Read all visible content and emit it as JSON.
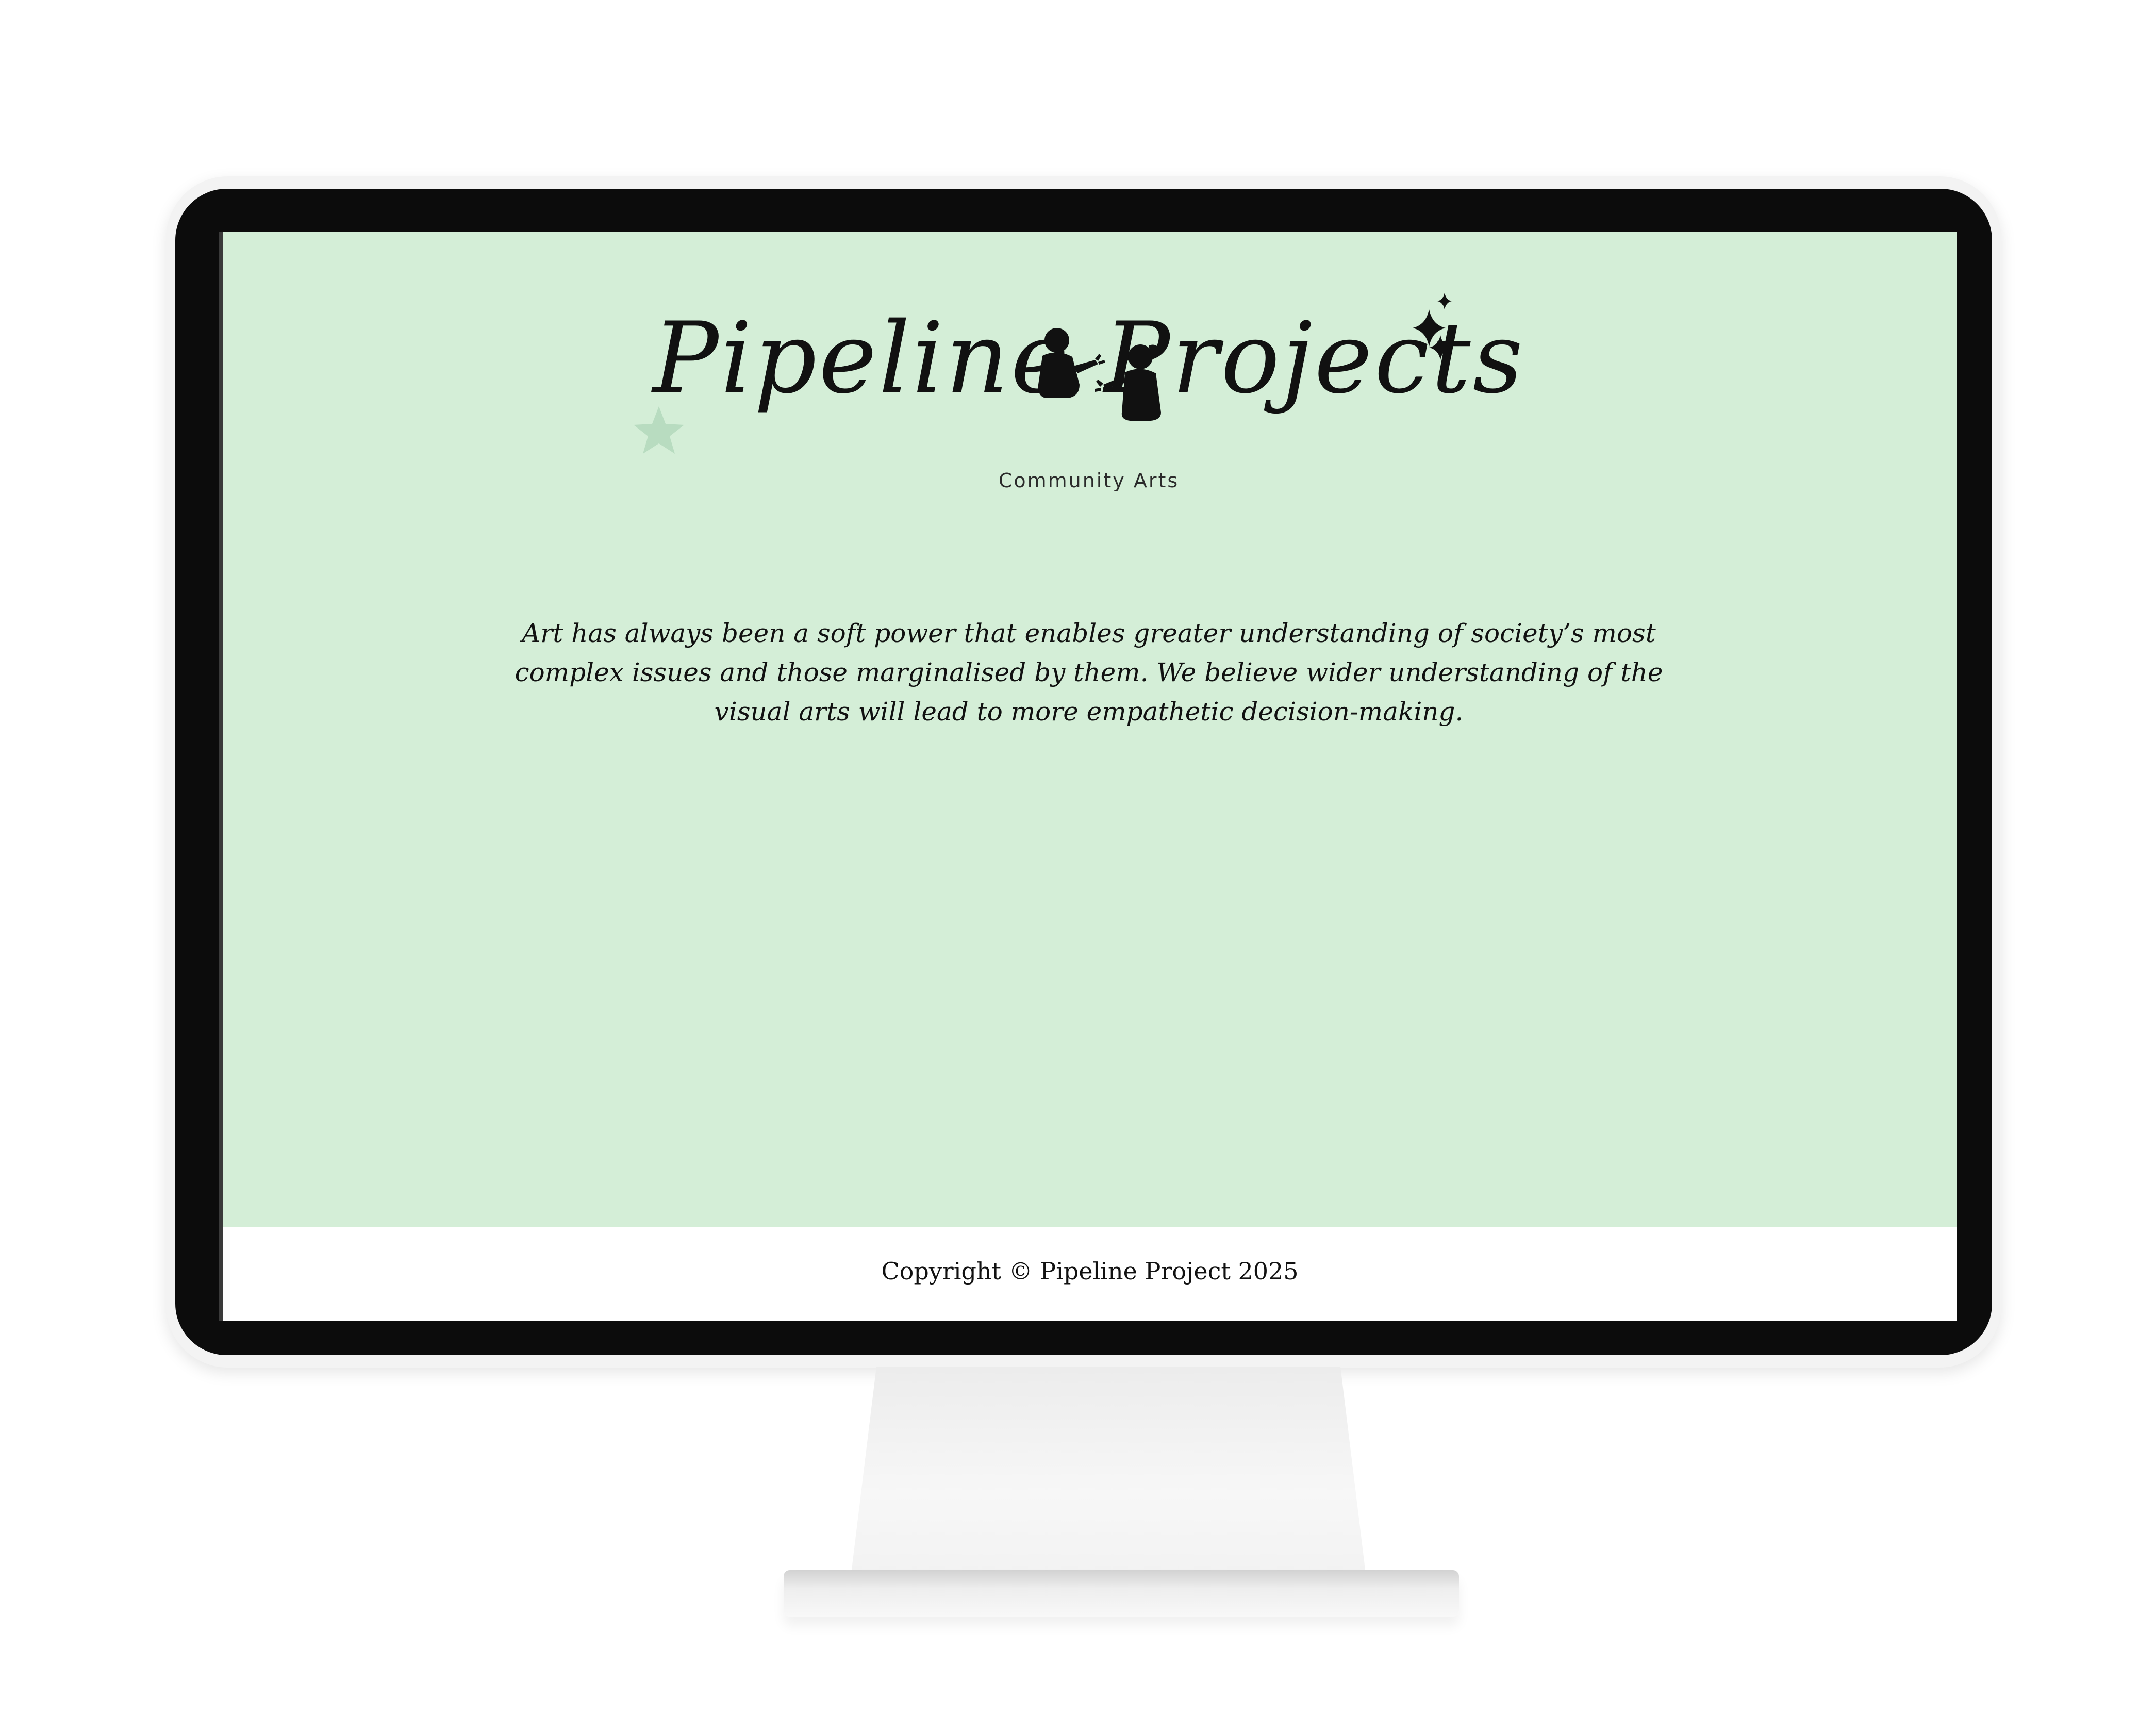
{
  "site": {
    "logo_text": "Pipeline Projects",
    "tagline": "Community Arts"
  },
  "main": {
    "mission_statement": "Art has always been a soft power that enables greater understanding of society’s most complex issues and those marginalised by them. We believe wider understanding of the visual arts will lead to more empathetic decision-making."
  },
  "footer": {
    "copyright": "Copyright © Pipeline Project 2025"
  },
  "colors": {
    "page_background": "#d4eed7",
    "footer_background": "#ffffff",
    "text": "#111111",
    "monitor_bezel": "#0c0c0c"
  },
  "icons": [
    "sparkle-icon",
    "star-icon",
    "figures-illustration"
  ]
}
